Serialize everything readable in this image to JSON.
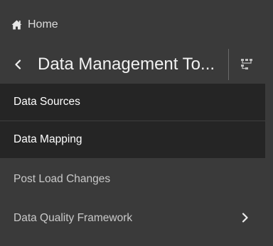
{
  "nav": {
    "home_label": "Home"
  },
  "header": {
    "title": "Data Management To..."
  },
  "menu": {
    "items": [
      {
        "label": "Data Sources",
        "active": true
      },
      {
        "label": "Data Mapping",
        "active": true
      },
      {
        "label": "Post Load Changes",
        "active": false
      },
      {
        "label": "Data Quality Framework",
        "active": false,
        "has_submenu": true
      }
    ]
  },
  "colors": {
    "panel_bg": "#3a3a3a",
    "active_item_bg": "#252525",
    "text_primary": "#f2f2f2",
    "text_muted": "#c9c9c9"
  }
}
